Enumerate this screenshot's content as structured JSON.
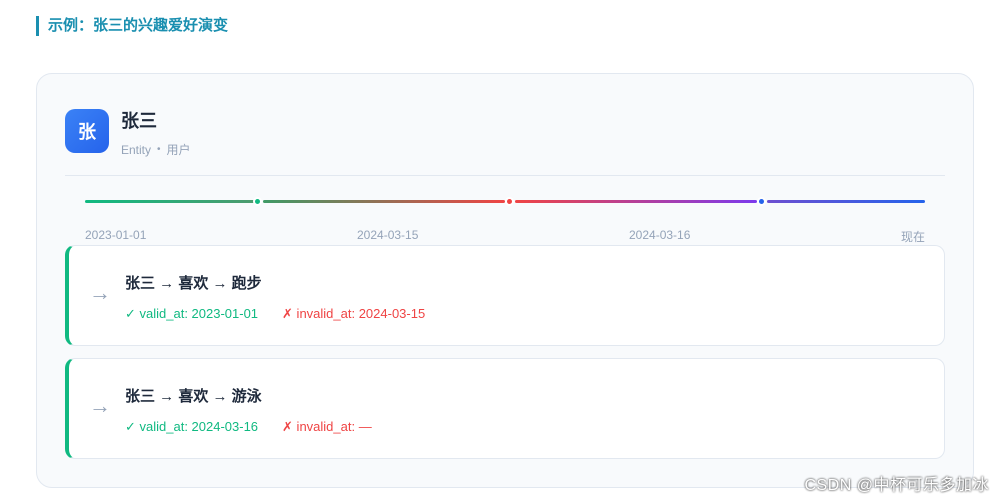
{
  "section_title": "示例：张三的兴趣爱好演变",
  "entity": {
    "avatar_char": "张",
    "name": "张三",
    "type": "Entity",
    "separator": "•",
    "category": "用户"
  },
  "timeline": {
    "labels": [
      "2023-01-01",
      "2024-03-15",
      "2024-03-16",
      "现在"
    ],
    "colors": {
      "green": "#10b981",
      "red": "#ef4444",
      "blue": "#2563eb"
    }
  },
  "facts": [
    {
      "arrow": "→",
      "title": "张三 → 喜欢 → 跑步",
      "valid": "✓ valid_at: 2023-01-01",
      "invalid": "✗ invalid_at: 2024-03-15"
    },
    {
      "arrow": "→",
      "title": "张三 → 喜欢 → 游泳",
      "valid": "✓ valid_at: 2024-03-16",
      "invalid": "✗ invalid_at: —"
    }
  ],
  "watermark": "CSDN @中杯可乐多加冰"
}
